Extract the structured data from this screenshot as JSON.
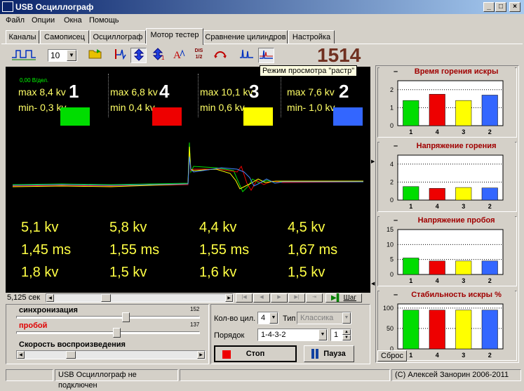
{
  "window": {
    "title": "USB Осциллограф",
    "controls": [
      "_",
      "□",
      "×"
    ]
  },
  "menu": [
    "Файл",
    "Опции",
    "Окна",
    "Помощь"
  ],
  "tabs": [
    "Каналы",
    "Самописец",
    "Осциллограф",
    "Мотор тестер",
    "Сравнение цилиндров",
    "Настройка"
  ],
  "active_tab": "Мотор тестер",
  "toolbar": {
    "channel_select": "10",
    "tooltip": "Режим просмотра \"растр\"",
    "rpm": "1514",
    "div_label": "0,00 В/дел."
  },
  "cylinders": [
    {
      "num": "1",
      "max": "max 8,4 kv",
      "min": "min- 0,3 kv",
      "color": "#00dd00",
      "burn_v": "5,1 kv",
      "burn_t": "1,45 ms",
      "peak_v": "1,8 kv"
    },
    {
      "num": "4",
      "max": "max 6,8 kv",
      "min": "min 0,4 kv",
      "color": "#ee0000",
      "burn_v": "5,8 kv",
      "burn_t": "1,55 ms",
      "peak_v": "1,5 kv"
    },
    {
      "num": "3",
      "max": "max 10,1 kv",
      "min": "min 0,6 kv",
      "color": "#ffff00",
      "burn_v": "4,4 kv",
      "burn_t": "1,55 ms",
      "peak_v": "1,6 kv"
    },
    {
      "num": "2",
      "max": "max 7,6 kv",
      "min": "min- 1,0 kv",
      "color": "#3366ff",
      "burn_v": "4,5 kv",
      "burn_t": "1,67 ms",
      "peak_v": "1,5 kv"
    }
  ],
  "time_bar": {
    "label": "5,125 сек",
    "step": "Шаг"
  },
  "controls": {
    "sync_label": "синхронизация",
    "sync_value": "152",
    "breakdown_label": "пробой",
    "breakdown_value": "137",
    "speed_label": "Скорость воспроизведения",
    "cyl_count_label": "Кол-во цил.",
    "cyl_count": "4",
    "type_label": "Тип",
    "type_value": "Классика",
    "order_label": "Порядок",
    "order_value": "1-4-3-2",
    "order_spin": "1",
    "stop": "Стоп",
    "pause": "Пауза"
  },
  "charts": [
    {
      "title": "Время горения искры",
      "ylabels": [
        "2",
        "1",
        "0"
      ],
      "ylim": [
        0,
        2.5
      ],
      "values": [
        1.4,
        1.75,
        1.4,
        1.7
      ]
    },
    {
      "title": "Напряжение горения",
      "ylabels": [
        "4",
        "2",
        "0"
      ],
      "ylim": [
        0,
        5
      ],
      "values": [
        1.5,
        1.3,
        1.4,
        1.35
      ]
    },
    {
      "title": "Напряжение пробоя",
      "ylabels": [
        "15",
        "10",
        "5",
        "0"
      ],
      "ylim": [
        0,
        15
      ],
      "values": [
        5.5,
        4.5,
        4.5,
        4.5
      ]
    },
    {
      "title": "Стабильность искры %",
      "ylabels": [
        "100",
        "50",
        "0"
      ],
      "ylim": [
        0,
        110
      ],
      "values": [
        95,
        95,
        95,
        95
      ]
    }
  ],
  "chart_categories": [
    "1",
    "4",
    "3",
    "2"
  ],
  "reset_label": "Сброс",
  "status": {
    "usb": "USB Осциллограф не подключен",
    "copyright": "(C) Алексей Занорин 2006-2011"
  }
}
